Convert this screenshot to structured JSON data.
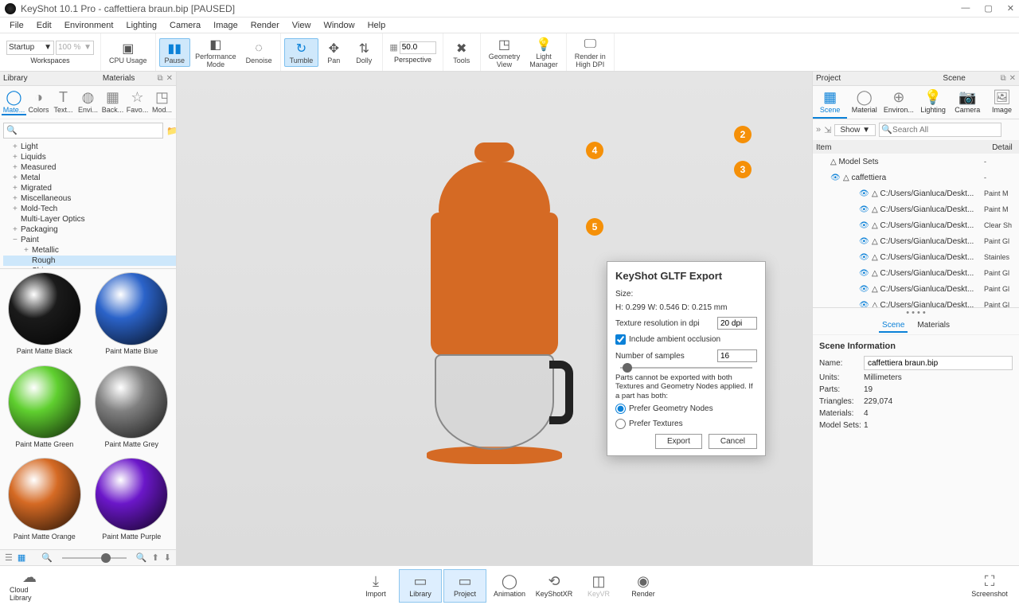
{
  "title": "KeyShot 10.1 Pro  - caffettiera braun.bip [PAUSED]",
  "menus": [
    "File",
    "Edit",
    "Environment",
    "Lighting",
    "Camera",
    "Image",
    "Render",
    "View",
    "Window",
    "Help"
  ],
  "toolbar": {
    "startup": "Startup",
    "zoom": "100 %",
    "workspaces": "Workspaces",
    "cpuUsage": "CPU Usage",
    "pause": "Pause",
    "perfMode1": "Performance",
    "perfMode2": "Mode",
    "denoise": "Denoise",
    "tumble": "Tumble",
    "pan": "Pan",
    "dolly": "Dolly",
    "fov": "50.0",
    "perspective": "Perspective",
    "tools": "Tools",
    "geomView1": "Geometry",
    "geomView2": "View",
    "lightMgr1": "Light",
    "lightMgr2": "Manager",
    "renderHi1": "Render in",
    "renderHi2": "High DPI"
  },
  "library": {
    "panelLabel": "Library",
    "panelCenter": "Materials",
    "tabs": [
      "Mate...",
      "Colors",
      "Text...",
      "Envi...",
      "Back...",
      "Favo...",
      "Mod..."
    ],
    "tree": [
      {
        "pm": "+",
        "label": "Light",
        "ind": 0
      },
      {
        "pm": "+",
        "label": "Liquids",
        "ind": 0
      },
      {
        "pm": "+",
        "label": "Measured",
        "ind": 0
      },
      {
        "pm": "+",
        "label": "Metal",
        "ind": 0
      },
      {
        "pm": "+",
        "label": "Migrated",
        "ind": 0
      },
      {
        "pm": "+",
        "label": "Miscellaneous",
        "ind": 0
      },
      {
        "pm": "+",
        "label": "Mold-Tech",
        "ind": 0
      },
      {
        "pm": "",
        "label": "Multi-Layer Optics",
        "ind": 0
      },
      {
        "pm": "+",
        "label": "Packaging",
        "ind": 0
      },
      {
        "pm": "−",
        "label": "Paint",
        "ind": 0
      },
      {
        "pm": "+",
        "label": "Metallic",
        "ind": 1
      },
      {
        "pm": "",
        "label": "Rough",
        "ind": 1,
        "sel": true
      },
      {
        "pm": "",
        "label": "Shiny",
        "ind": 1
      }
    ],
    "swatches": [
      {
        "name": "Paint Matte Black",
        "color": "#1a1a1a"
      },
      {
        "name": "Paint Matte Blue",
        "color": "#2b63c9"
      },
      {
        "name": "Paint Matte Green",
        "color": "#5fcf2f"
      },
      {
        "name": "Paint Matte Grey",
        "color": "#7f7f7f"
      },
      {
        "name": "Paint Matte Orange",
        "color": "#d56a24"
      },
      {
        "name": "Paint Matte Purple",
        "color": "#6b17c9"
      }
    ]
  },
  "dialog": {
    "title": "KeyShot GLTF Export",
    "sizeLabel": "Size:",
    "sizeValue": "H: 0.299 W: 0.546 D: 0.215   mm",
    "texResLabel": "Texture resolution in dpi",
    "texResValue": "20 dpi",
    "aoLabel": "Include ambient occlusion",
    "samplesLabel": "Number of samples",
    "samplesValue": "16",
    "note": "Parts cannot be exported with both Textures and Geometry Nodes applied. If a part has both:",
    "opt1": "Prefer Geometry Nodes",
    "opt2": "Prefer Textures",
    "export": "Export",
    "cancel": "Cancel"
  },
  "annotations": {
    "a2": "2",
    "a3": "3",
    "a4": "4",
    "a5": "5"
  },
  "project": {
    "panelLabel": "Project",
    "panelCenter": "Scene",
    "tabs": [
      "Scene",
      "Material",
      "Environ...",
      "Lighting",
      "Camera",
      "Image"
    ],
    "showBtn": "Show ▼",
    "searchPlaceholder": "Search All",
    "headItem": "Item",
    "headDetail": "Detail",
    "items": [
      {
        "lvl": 0,
        "name": "Model Sets",
        "det": "-",
        "eye": false
      },
      {
        "lvl": 1,
        "name": "caffettiera",
        "det": "-",
        "eye": true
      },
      {
        "lvl": 2,
        "name": "C:/Users/Gianluca/Deskt...",
        "det": "Paint M",
        "eye": true
      },
      {
        "lvl": 2,
        "name": "C:/Users/Gianluca/Deskt...",
        "det": "Paint M",
        "eye": true
      },
      {
        "lvl": 2,
        "name": "C:/Users/Gianluca/Deskt...",
        "det": "Clear Sh",
        "eye": true
      },
      {
        "lvl": 2,
        "name": "C:/Users/Gianluca/Deskt...",
        "det": "Paint Gl",
        "eye": true
      },
      {
        "lvl": 2,
        "name": "C:/Users/Gianluca/Deskt...",
        "det": "Stainles",
        "eye": true
      },
      {
        "lvl": 2,
        "name": "C:/Users/Gianluca/Deskt...",
        "det": "Paint Gl",
        "eye": true
      },
      {
        "lvl": 2,
        "name": "C:/Users/Gianluca/Deskt...",
        "det": "Paint Gl",
        "eye": true
      },
      {
        "lvl": 2,
        "name": "C:/Users/Gianluca/Deskt...",
        "det": "Paint Gl",
        "eye": true
      }
    ],
    "subtabs": [
      "Scene",
      "Materials"
    ],
    "info": {
      "heading": "Scene Information",
      "nameLabel": "Name:",
      "nameValue": "caffettiera braun.bip",
      "unitsLabel": "Units:",
      "unitsValue": "Millimeters",
      "partsLabel": "Parts:",
      "partsValue": "19",
      "trianglesLabel": "Triangles:",
      "trianglesValue": "229,074",
      "materialsLabel": "Materials:",
      "materialsValue": "4",
      "modelSetsLabel": "Model Sets:",
      "modelSetsValue": "1"
    }
  },
  "bottom": {
    "cloud": "Cloud Library",
    "import": "Import",
    "library": "Library",
    "project": "Project",
    "animation": "Animation",
    "keyshotxr": "KeyShotXR",
    "keyvr": "KeyVR",
    "render": "Render",
    "screenshot": "Screenshot"
  }
}
